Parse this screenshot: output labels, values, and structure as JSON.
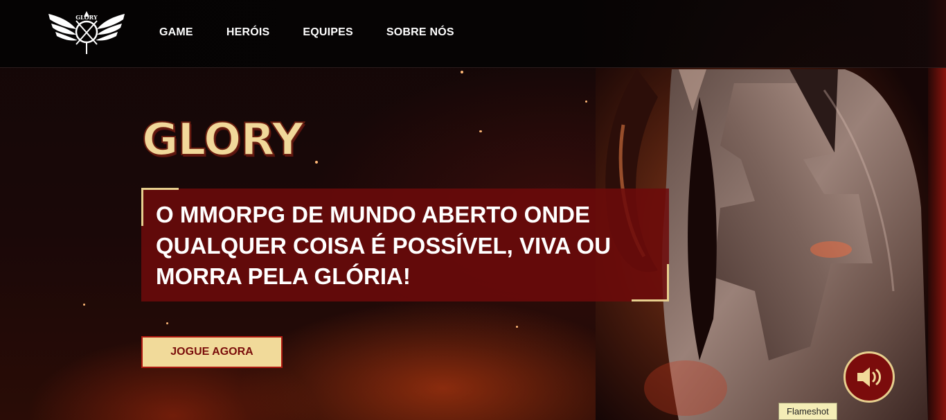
{
  "nav": {
    "logo_text": "GLORY",
    "items": [
      {
        "label": "GAME"
      },
      {
        "label": "HERÓIS"
      },
      {
        "label": "EQUIPES"
      },
      {
        "label": "SOBRE NÓS"
      }
    ]
  },
  "hero": {
    "title": "GLORY",
    "tagline": "O MMORPG DE MUNDO ABERTO ONDE QUALQUER COISA É POSSÍVEL, VIVA OU MORRA PELA GLÓRIA!",
    "cta_label": "JOGUE AGORA"
  },
  "sound_button": {
    "icon": "speaker-icon"
  },
  "tooltip": {
    "text": "Flameshot"
  },
  "colors": {
    "accent_gold": "#f1da9a",
    "accent_red": "#7b0c0c",
    "nav_background": "#050303"
  }
}
